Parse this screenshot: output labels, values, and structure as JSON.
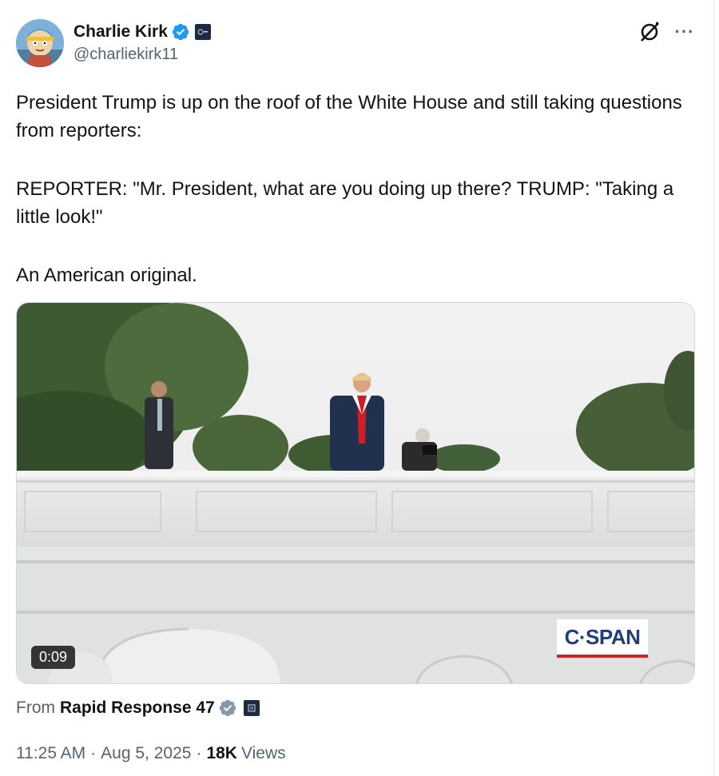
{
  "author": {
    "display_name": "Charlie Kirk",
    "handle": "@charliekirk11"
  },
  "tweet": {
    "paragraphs": [
      "President Trump is up on the roof of the White House and still taking questions from reporters:",
      "REPORTER: \"Mr. President, what are you doing up there?   TRUMP: \"Taking a little look!\"",
      "An American original."
    ]
  },
  "media": {
    "video_duration": "0:09",
    "watermark": "C·SPAN"
  },
  "source": {
    "label": "From",
    "name": "Rapid Response 47"
  },
  "meta": {
    "time": "11:25 AM",
    "date": "Aug 5, 2025",
    "views_count": "18K",
    "views_label": "Views"
  },
  "icons": {
    "verified": "verified-badge-icon",
    "grok": "grok-icon",
    "more": "more-options-icon"
  },
  "colors": {
    "verified_blue": "#1d9bf0",
    "text_primary": "#0f1419",
    "text_secondary": "#536471"
  }
}
